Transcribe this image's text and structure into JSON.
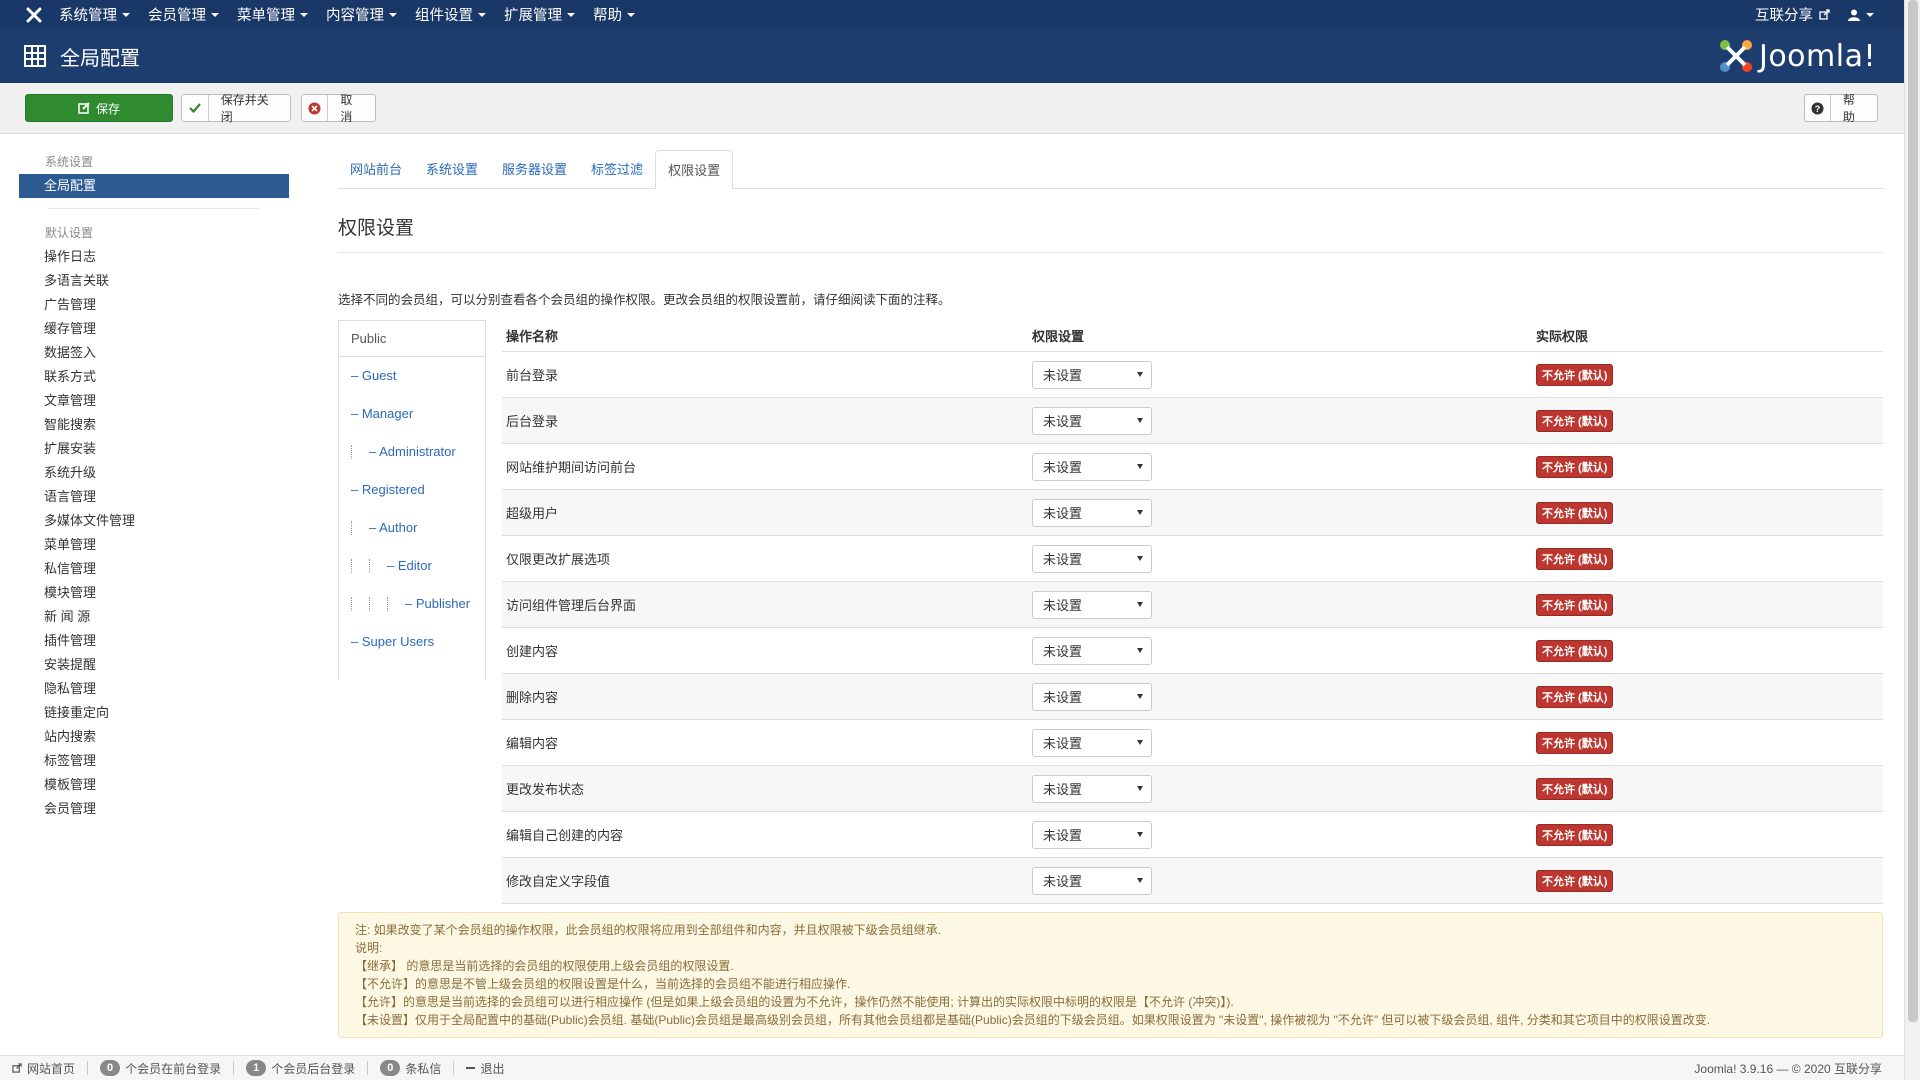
{
  "topnav": {
    "menu": [
      "系统管理",
      "会员管理",
      "菜单管理",
      "内容管理",
      "组件设置",
      "扩展管理",
      "帮助"
    ],
    "site_link": "互联分享"
  },
  "header": {
    "title": "全局配置",
    "brand": "Joomla!"
  },
  "toolbar": {
    "save": "保存",
    "save_close": "保存并关闭",
    "cancel": "取消",
    "help": "帮助"
  },
  "sidebar": {
    "head1": "系统设置",
    "active": "全局配置",
    "head2": "默认设置",
    "items": [
      "操作日志",
      "多语言关联",
      "广告管理",
      "缓存管理",
      "数据签入",
      "联系方式",
      "文章管理",
      "智能搜索",
      "扩展安装",
      "系统升级",
      "语言管理",
      "多媒体文件管理",
      "菜单管理",
      "私信管理",
      "模块管理",
      "新 闻 源",
      "插件管理",
      "安装提醒",
      "隐私管理",
      "链接重定向",
      "站内搜索",
      "标签管理",
      "模板管理",
      "会员管理"
    ]
  },
  "tabs": [
    "网站前台",
    "系统设置",
    "服务器设置",
    "标签过滤",
    "权限设置"
  ],
  "section_title": "权限设置",
  "intro": "选择不同的会员组，可以分别查看各个会员组的操作权限。更改会员组的权限设置前，请仔细阅读下面的注释。",
  "groups": [
    {
      "label": "Public",
      "depth": 0
    },
    {
      "label": "– Guest",
      "depth": 0
    },
    {
      "label": "– Manager",
      "depth": 0
    },
    {
      "label": "– Administrator",
      "depth": 1
    },
    {
      "label": "– Registered",
      "depth": 0
    },
    {
      "label": "– Author",
      "depth": 1
    },
    {
      "label": "– Editor",
      "depth": 2
    },
    {
      "label": "– Publisher",
      "depth": 3
    },
    {
      "label": "– Super Users",
      "depth": 0
    }
  ],
  "table": {
    "headers": [
      "操作名称",
      "权限设置",
      "实际权限"
    ],
    "select_value": "未设置",
    "badge": "不允许 (默认)",
    "rows": [
      "前台登录",
      "后台登录",
      "网站维护期间访问前台",
      "超级用户",
      "仅限更改扩展选项",
      "访问组件管理后台界面",
      "创建内容",
      "删除内容",
      "编辑内容",
      "更改发布状态",
      "编辑自己创建的内容",
      "修改自定义字段值"
    ]
  },
  "note": {
    "lines": [
      "注: 如果改变了某个会员组的操作权限，此会员组的权限将应用到全部组件和内容，并且权限被下级会员组继承.",
      "说明:",
      "【继承】 的意思是当前选择的会员组的权限使用上级会员组的权限设置.",
      "【不允许】的意思是不管上级会员组的权限设置是什么，当前选择的会员组不能进行相应操作.",
      "【允许】的意思是当前选择的会员组可以进行相应操作 (但是如果上级会员组的设置为不允许，操作仍然不能使用; 计算出的实际权限中标明的权限是【不允许 (冲突)】).",
      "【未设置】仅用于全局配置中的基础(Public)会员组. 基础(Public)会员组是最高级别会员组，所有其他会员组都是基础(Public)会员组的下级会员组。如果权限设置为 \"未设置\", 操作被视为 \"不允许\" 但可以被下级会员组, 组件, 分类和其它项目中的权限设置改变."
    ]
  },
  "status": {
    "home": "网站首页",
    "frontend_count": "0",
    "frontend_label": "个会员在前台登录",
    "backend_count": "1",
    "backend_label": "个会员后台登录",
    "msg_count": "0",
    "msg_label": "条私信",
    "logout": "退出",
    "version": "Joomla! 3.9.16 — © 2020 互联分享"
  }
}
